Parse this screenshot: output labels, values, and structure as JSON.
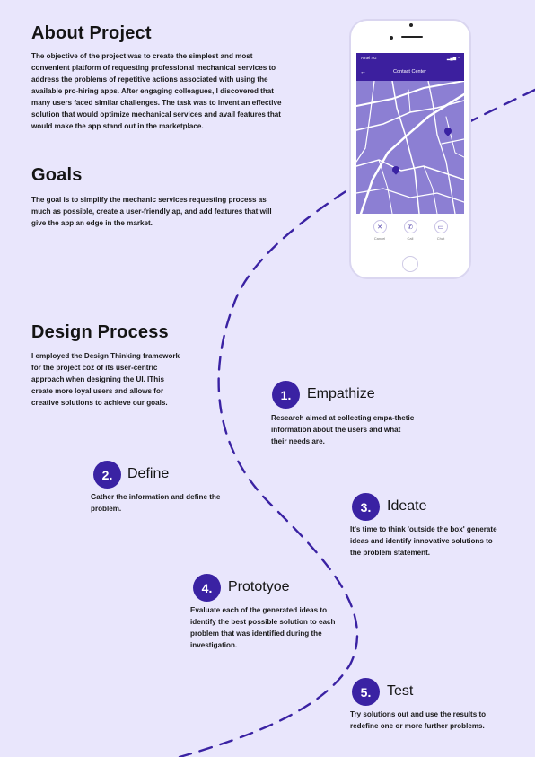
{
  "about": {
    "heading": "About Project",
    "text": "The objective of the project was to create the simplest and most convenient platform of requesting professional mechanical services to address the problems of repetitive actions associated with using the available pro-hiring apps. After engaging colleagues, I discovered that many users faced similar challenges. The task was to invent an effective solution that would optimize mechanical services and avail features that would make the app stand out in the marketplace."
  },
  "goals": {
    "heading": "Goals",
    "text": "The goal is to simplify the mechanic services requesting process as much as possible, create a user-friendly ap, and add features that will give the app an edge in the market."
  },
  "design_process": {
    "heading": "Design Process",
    "text": "I employed the Design Thinking framework for the project coz of its user-centric approach when designing the UI. IThis create more loyal users and allows for creative solutions to achieve our goals."
  },
  "steps": [
    {
      "number": "1.",
      "title": "Empathize",
      "text": "Research aimed at collecting empa-thetic information about the users and what their needs are."
    },
    {
      "number": "2.",
      "title": "Define",
      "text": "Gather the information and define the problem."
    },
    {
      "number": "3.",
      "title": "Ideate",
      "text": "It's time to think 'outside the box' generate ideas and identify innovative solutions to the problem statement."
    },
    {
      "number": "4.",
      "title": "Prototyoe",
      "text": "Evaluate each of the generated ideas to identify the best possible solution to each problem that was identified during the investigation."
    },
    {
      "number": "5.",
      "title": "Test",
      "text": "Try solutions out and use the results to redefine one or more further problems."
    }
  ],
  "phone": {
    "status_left": "Airtel 4G",
    "app_title": "Contact Center",
    "actions": [
      {
        "label": "Cancel",
        "icon": "close-icon"
      },
      {
        "label": "Call",
        "icon": "phone-icon"
      },
      {
        "label": "Chat",
        "icon": "chat-icon"
      }
    ]
  },
  "colors": {
    "background": "#e9e6fc",
    "accent": "#3a22a3",
    "map": "#8c7fd3"
  }
}
